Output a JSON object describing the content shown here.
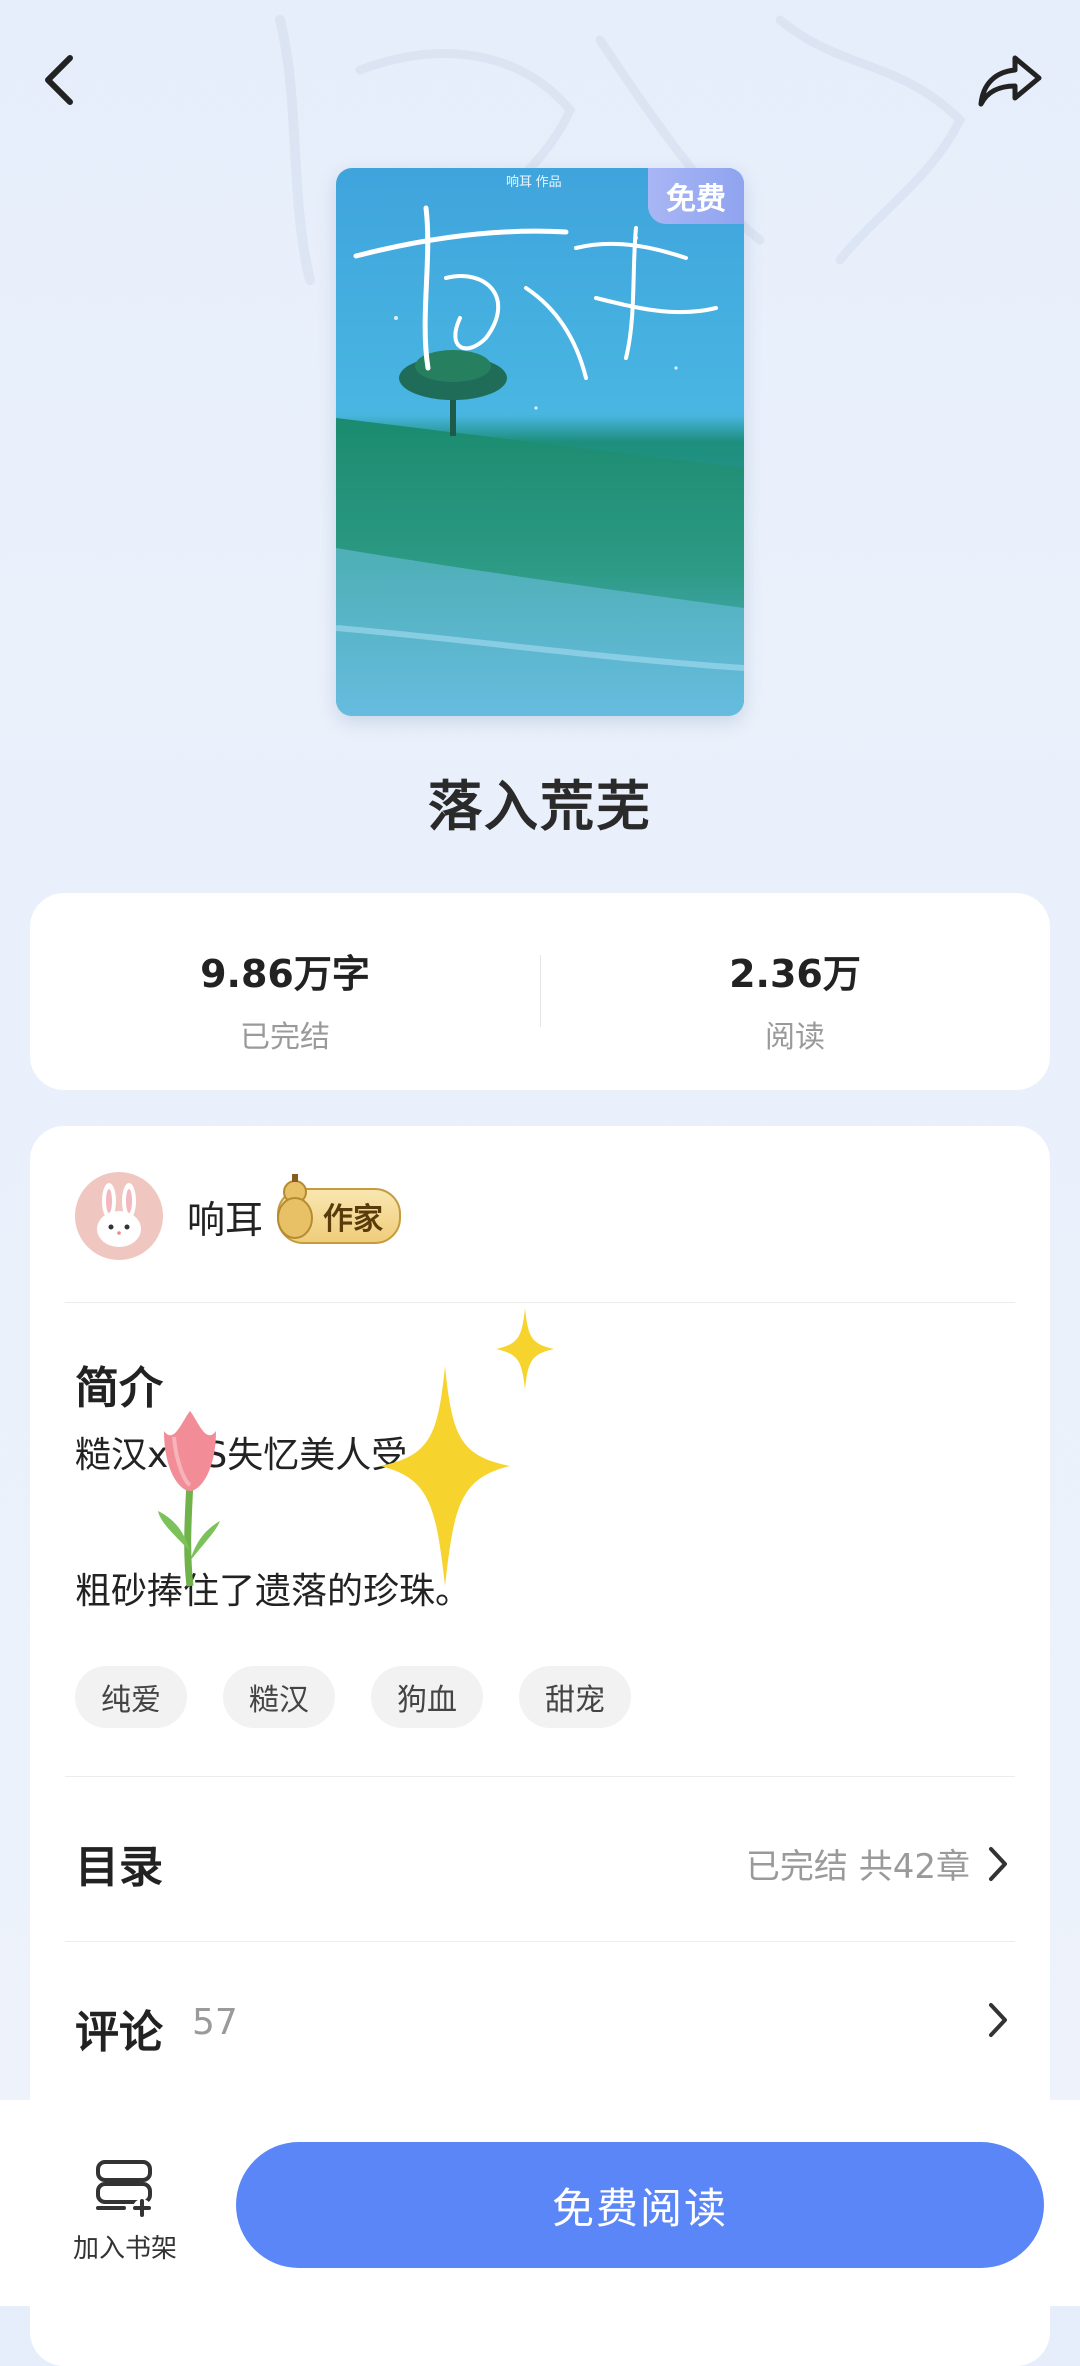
{
  "book": {
    "title": "落入荒芜",
    "cover_badge": "免费",
    "cover_author_line": "响耳 作品"
  },
  "stats": {
    "word_count": "9.86万字",
    "word_count_label": "已完结",
    "reads": "2.36万",
    "reads_label": "阅读"
  },
  "author": {
    "name": "响耳",
    "badge": "作家"
  },
  "intro": {
    "heading": "简介",
    "line1": "糙汉x VS失忆美人受",
    "line2": "粗砂捧住了遗落的珍珠。"
  },
  "tags": [
    "纯爱",
    "糙汉",
    "狗血",
    "甜宠"
  ],
  "toc": {
    "heading": "目录",
    "status": "已完结 共42章"
  },
  "comments": {
    "heading": "评论",
    "count": "57"
  },
  "bottom": {
    "shelf_label": "加入书架",
    "read_button": "免费阅读"
  },
  "colors": {
    "accent": "#5b86f7",
    "badge_gold": "#efcd7a"
  }
}
